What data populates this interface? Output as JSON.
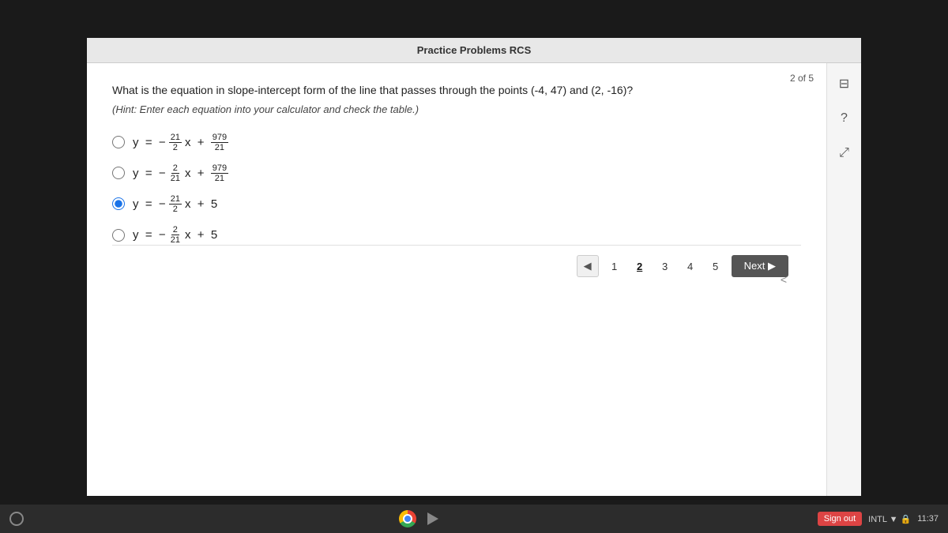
{
  "header": {
    "title": "Practice Problems RCS"
  },
  "page_indicator": {
    "text": "2 of 5"
  },
  "question": {
    "text": "What is the equation in slope-intercept form of the line that passes through the points (-4, 47) and (2, -16)?",
    "hint": "(Hint: Enter each equation into your calculator and check the table.)"
  },
  "options": [
    {
      "id": "opt1",
      "label": "y = −(21/2)x + 979/21",
      "selected": false,
      "latex": "y = − 21/2 x + 979/21"
    },
    {
      "id": "opt2",
      "label": "y = −(2/21)x + 979/21",
      "selected": false,
      "latex": "y = − 2/21 x + 979/21"
    },
    {
      "id": "opt3",
      "label": "y = −(21/2)x + 5",
      "selected": true,
      "latex": "y = − 21/2 x + 5"
    },
    {
      "id": "opt4",
      "label": "y = −(2/21)x + 5",
      "selected": false,
      "latex": "y = − 2/21 x + 5"
    }
  ],
  "navigation": {
    "prev_label": "◀",
    "pages": [
      "1",
      "2",
      "3",
      "4",
      "5"
    ],
    "current_page": 2,
    "next_label": "Next ▶"
  },
  "sidebar_icons": {
    "bookmark": "⊟",
    "help": "?",
    "expand": "⤢"
  },
  "taskbar": {
    "sign_out": "Sign out",
    "language": "INTL",
    "time": "11:37"
  }
}
